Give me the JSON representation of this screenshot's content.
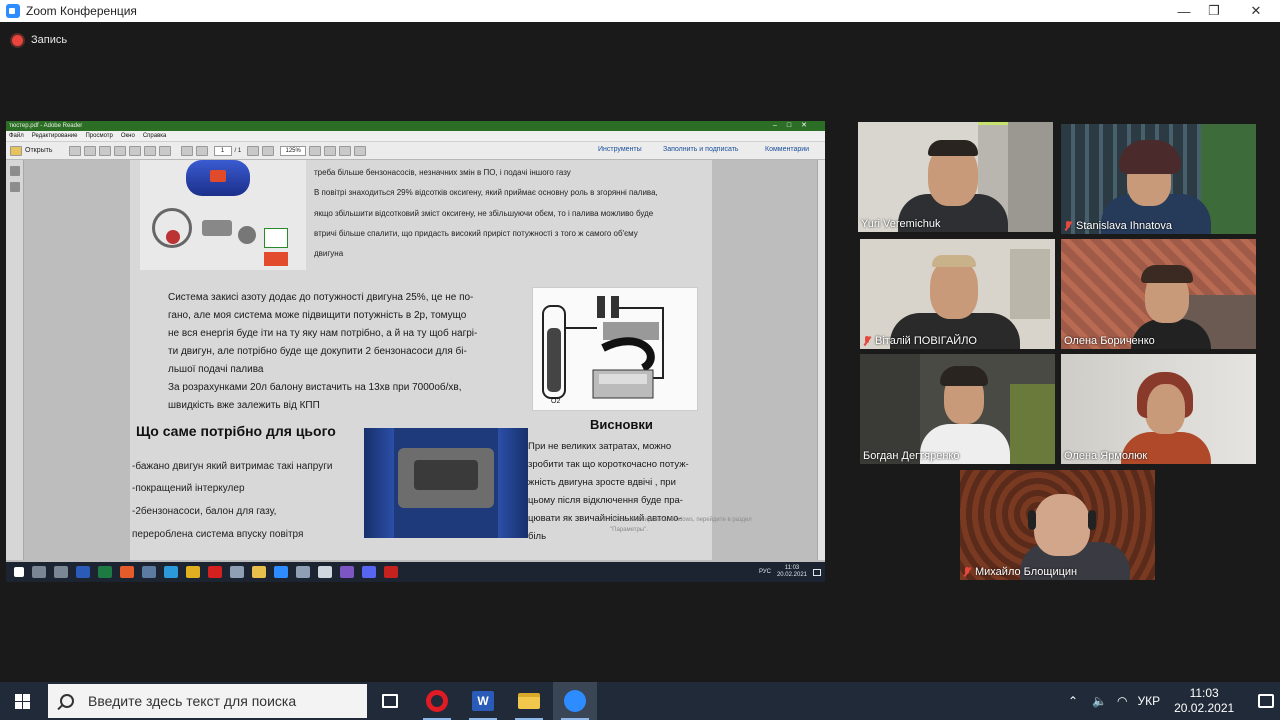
{
  "window": {
    "title": "Zoom Конференция",
    "minimize": "—",
    "maximize": "❐",
    "close": "✕"
  },
  "recording": {
    "label": "Запись"
  },
  "reader": {
    "title": "тюстер.pdf - Adobe Reader",
    "menu": [
      "Файл",
      "Редактирование",
      "Просмотр",
      "Окно",
      "Справка"
    ],
    "open_label": "Открыть",
    "page_num": "1",
    "page_total": "/ 1",
    "zoom": "125%",
    "tools_link": "Инструменты",
    "fill_sign_link": "Заполнить и подписать",
    "comments_link": "Комментарии"
  },
  "doc": {
    "top_line1": "треба  більше бензонасосів,   незначних змін в ПО, і подачі іншого газу",
    "top_line2": "В повітрі знаходиться 29% відсотків оксигену, який приймає основну роль в згорянні палива,",
    "top_line3": "якщо збільшити відсотковий зміст оксигену, не збільшуючи обєм, то і палива можливо буде",
    "top_line4": "втричі більше спалити, що придасть високий приріст потужності з того ж самого об'єму",
    "top_line5": "двигуна",
    "mid_lines": [
      "Система закисі азоту додає до потужності двигуна 25%, це не по-",
      "гано, але моя система може підвищити потужність в 2р, томущо",
      "не вся енергія буде іти на ту яку нам потрібно, а й на ту щоб нагрі-",
      "ти двигун, але потрібно буде ще докупити 2 бензонасоси для бі-",
      "льшої подачі палива"
    ],
    "calc_lines": [
      "За розрахунками 20л балону вистачить на 13хв при 7000об/хв,",
      "швидкість вже залежить від КПП"
    ],
    "need_heading": "Що саме потрібно для цього",
    "need_items": [
      "-бажано двигун який витримає такі напруги",
      "-покращений інтеркулер",
      "-2бензонасоси, балон для газу,",
      "перероблена система впуску повітря"
    ],
    "conclusion_heading": "Висновки",
    "conclusion_lines": [
      "При не великих затратах, можно",
      "зробити так що короткочасно потуж-",
      "жність двигуна зросте вдвічі , при",
      "цьому після відключення буде пра-",
      "цювати як звичайнісінький автомо-",
      "біль"
    ],
    "watermark1": "Чтобы активировать Windows, перейдите в раздел",
    "watermark2": "\"Параметры\".",
    "diagram_label": "О2"
  },
  "inner_taskbar": {
    "lang": "РУС",
    "time": "11:03",
    "date": "20.02.2021"
  },
  "participants": [
    {
      "name": "Yuri  Veremichuk",
      "muted": false,
      "active": true
    },
    {
      "name": "Stanislava Ihnatova",
      "muted": true,
      "active": false
    },
    {
      "name": "Віталій ПОВІГАЙЛО",
      "muted": true,
      "active": false
    },
    {
      "name": "Олена Бориченко",
      "muted": false,
      "active": false
    },
    {
      "name": "Богдан Дегтяренко",
      "muted": false,
      "active": false
    },
    {
      "name": "Олена Ярмолюк",
      "muted": false,
      "active": false
    },
    {
      "name": "Михайло Блощицин",
      "muted": true,
      "active": false
    }
  ],
  "taskbar": {
    "search_placeholder": "Введите здесь текст для поиска",
    "lang": "УКР",
    "time": "11:03",
    "date": "20.02.2021"
  },
  "colors": {
    "active_speaker": "#c7e26e",
    "zoom_blue": "#2d8cff",
    "muted_red": "#e5483e",
    "taskbar": "#202a38"
  }
}
